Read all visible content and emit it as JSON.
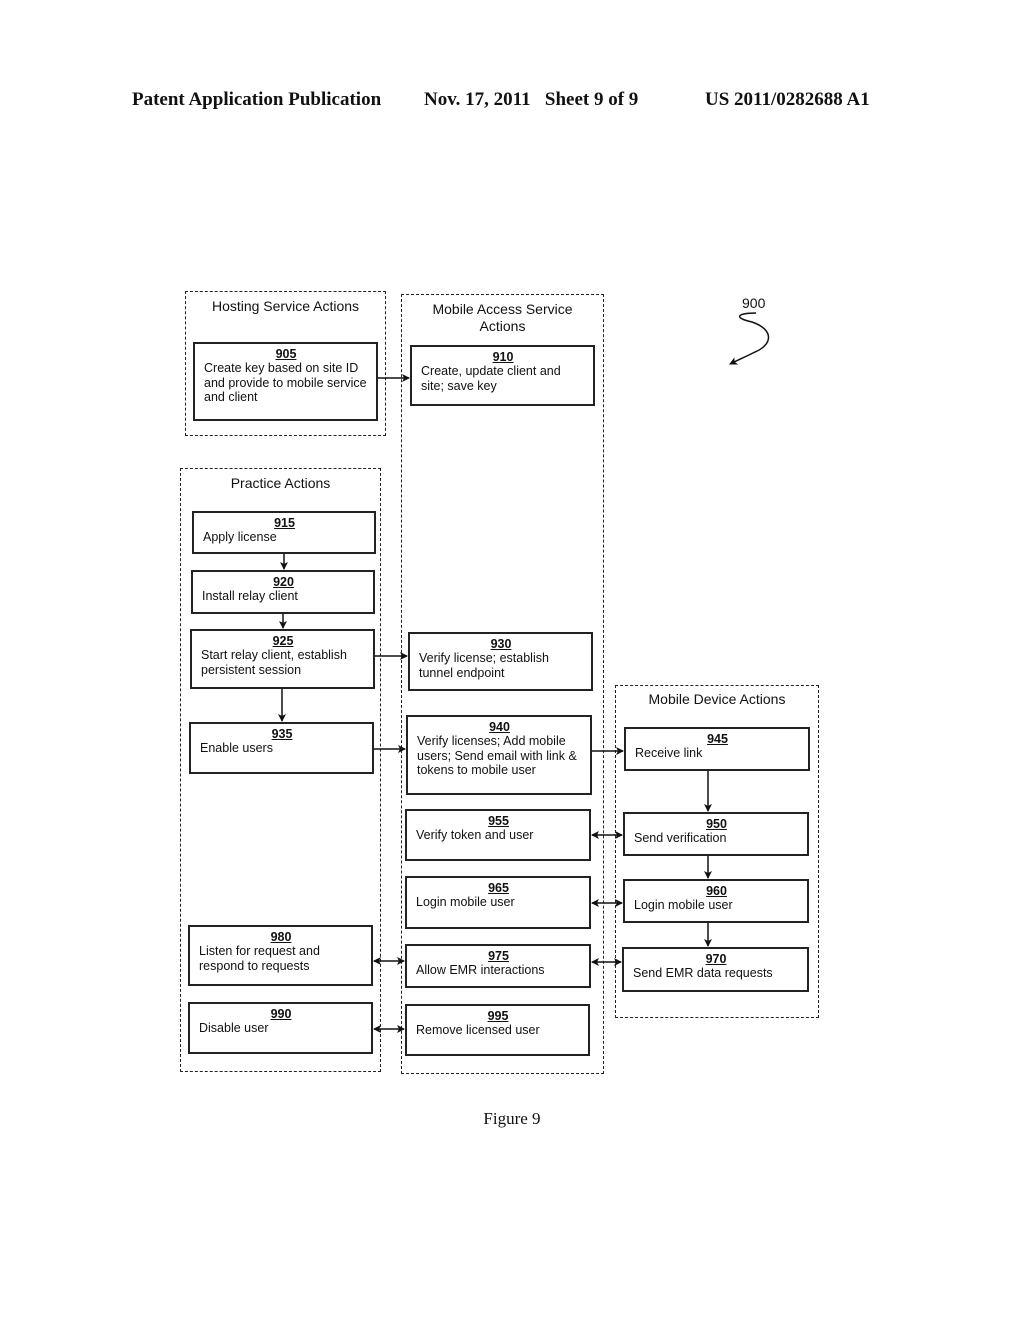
{
  "header": {
    "publication": "Patent Application Publication",
    "date_sheet": "Nov. 17, 2011   Sheet 9 of 9",
    "number": "US 2011/0282688 A1"
  },
  "figure": {
    "reference": "900",
    "caption": "Figure 9"
  },
  "lanes": {
    "hosting": "Hosting Service Actions",
    "mobile_access": "Mobile Access Service Actions",
    "practice": "Practice Actions",
    "mobile_device": "Mobile Device Actions"
  },
  "steps": {
    "s905": {
      "num": "905",
      "text": "Create key based on site ID and provide to mobile service and client"
    },
    "s910": {
      "num": "910",
      "text": "Create, update client and site; save key"
    },
    "s915": {
      "num": "915",
      "text": "Apply license"
    },
    "s920": {
      "num": "920",
      "text": "Install relay client"
    },
    "s925": {
      "num": "925",
      "text": "Start relay client, establish persistent session"
    },
    "s930": {
      "num": "930",
      "text": "Verify license; establish tunnel endpoint"
    },
    "s935": {
      "num": "935",
      "text": "Enable users"
    },
    "s940": {
      "num": "940",
      "text": "Verify licenses; Add mobile users; Send email with link & tokens to mobile user"
    },
    "s945": {
      "num": "945",
      "text": "Receive link"
    },
    "s950": {
      "num": "950",
      "text": "Send verification"
    },
    "s955": {
      "num": "955",
      "text": "Verify token and user"
    },
    "s960": {
      "num": "960",
      "text": "Login mobile user"
    },
    "s965": {
      "num": "965",
      "text": "Login mobile user"
    },
    "s970": {
      "num": "970",
      "text": "Send EMR data requests"
    },
    "s975": {
      "num": "975",
      "text": "Allow EMR interactions"
    },
    "s980": {
      "num": "980",
      "text": "Listen for request and respond to requests"
    },
    "s990": {
      "num": "990",
      "text": "Disable user"
    },
    "s995": {
      "num": "995",
      "text": "Remove licensed user"
    }
  },
  "connections": [
    {
      "from": "905",
      "to": "910",
      "type": "one-way"
    },
    {
      "from": "915",
      "to": "920",
      "type": "one-way"
    },
    {
      "from": "920",
      "to": "925",
      "type": "one-way"
    },
    {
      "from": "925",
      "to": "930",
      "type": "one-way"
    },
    {
      "from": "925",
      "to": "935",
      "type": "one-way"
    },
    {
      "from": "935",
      "to": "940",
      "type": "one-way"
    },
    {
      "from": "940",
      "to": "945",
      "type": "one-way"
    },
    {
      "from": "945",
      "to": "950",
      "type": "one-way"
    },
    {
      "from": "950",
      "to": "960",
      "type": "one-way"
    },
    {
      "from": "960",
      "to": "970",
      "type": "one-way"
    },
    {
      "from": "955",
      "to": "950",
      "type": "two-way"
    },
    {
      "from": "965",
      "to": "960",
      "type": "two-way"
    },
    {
      "from": "975",
      "to": "970",
      "type": "two-way"
    },
    {
      "from": "980",
      "to": "975",
      "type": "two-way"
    },
    {
      "from": "990",
      "to": "995",
      "type": "two-way"
    }
  ]
}
